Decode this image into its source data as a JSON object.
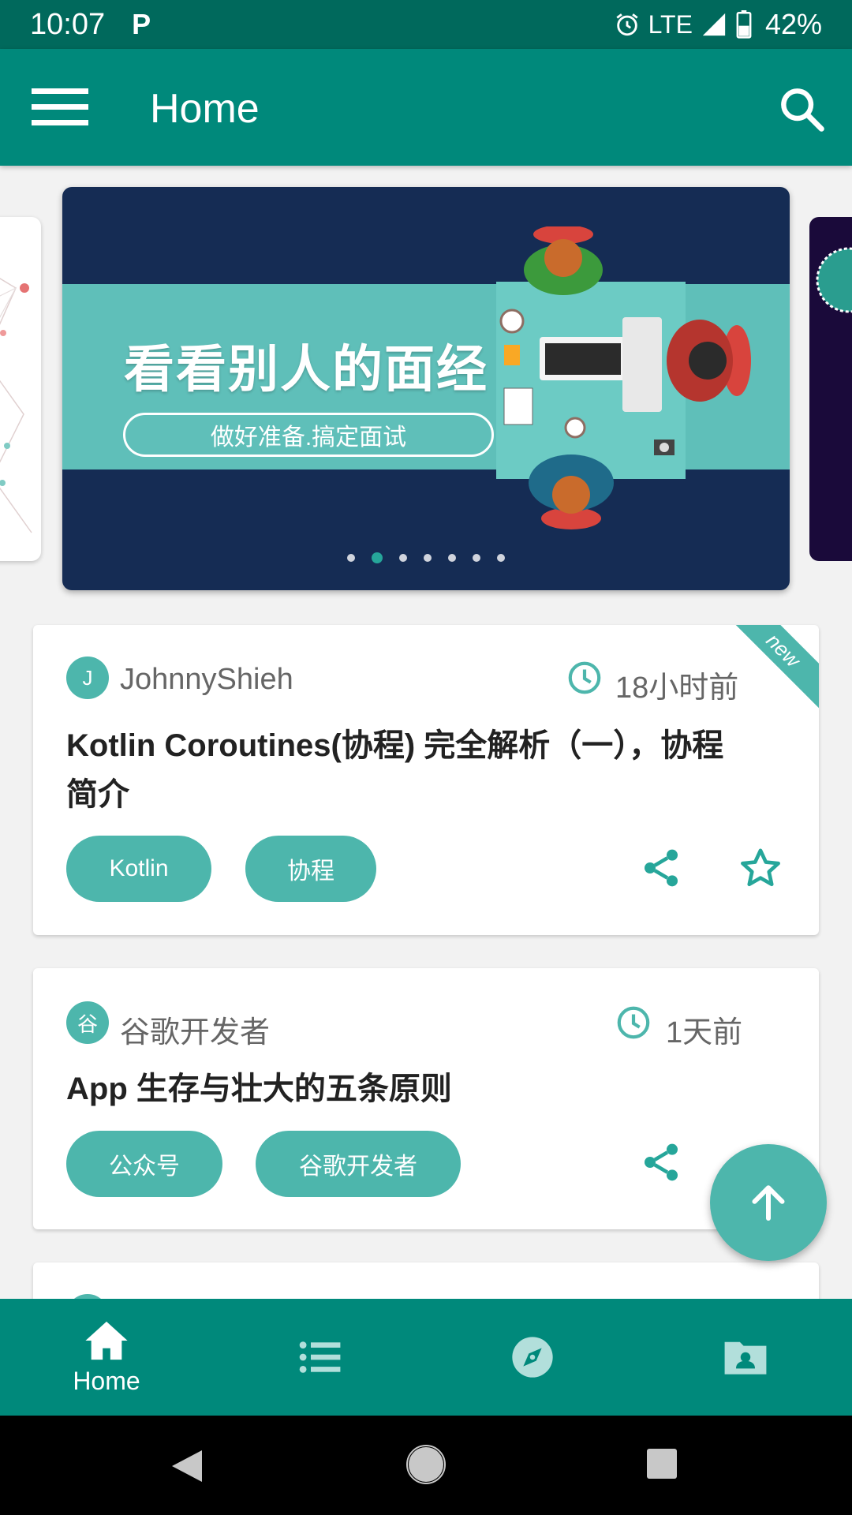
{
  "status_bar": {
    "time": "10:07",
    "carrier_icon": "P",
    "network": "LTE",
    "battery": "42%"
  },
  "app_bar": {
    "title": "Home",
    "menu_icon": "hamburger-icon",
    "search_icon": "search-icon"
  },
  "banner": {
    "headline": "看看别人的面经",
    "subtitle": "做好准备.搞定面试",
    "page_count": 7,
    "active_index": 1
  },
  "articles": [
    {
      "avatar": "J",
      "author": "JohnnyShieh",
      "time": "18小时前",
      "title_line1": "Kotlin Coroutines(协程) 完全解析（一），协程",
      "title_line2": "简介",
      "tags": [
        "Kotlin",
        "协程"
      ],
      "badge": "new"
    },
    {
      "avatar": "谷",
      "author": "谷歌开发者",
      "time": "1天前",
      "title_line1": "App 生存与壮大的五条原则",
      "tags": [
        "公众号",
        "谷歌开发者"
      ]
    }
  ],
  "bottom_nav": {
    "items": [
      {
        "label": "Home",
        "icon": "home-icon",
        "active": true
      },
      {
        "label": "",
        "icon": "list-icon"
      },
      {
        "label": "",
        "icon": "compass-icon"
      },
      {
        "label": "",
        "icon": "contact-folder-icon"
      }
    ]
  },
  "colors": {
    "primary": "#00897b",
    "primary_dark": "#00695c",
    "accent": "#4db6ac"
  }
}
